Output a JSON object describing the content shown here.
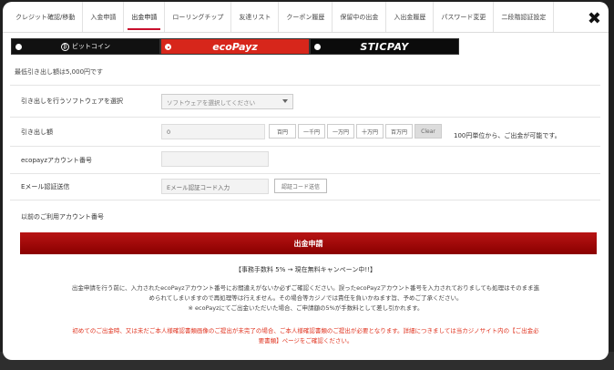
{
  "tabs": [
    {
      "label": "クレジット確認/移動"
    },
    {
      "label": "入金申請"
    },
    {
      "label": "出金申請"
    },
    {
      "label": "ローリングチップ"
    },
    {
      "label": "友達リスト"
    },
    {
      "label": "クーポン履歴"
    },
    {
      "label": "保留中の出金"
    },
    {
      "label": "入出金履歴"
    },
    {
      "label": "パスワード変更"
    },
    {
      "label": "二段階認証設定"
    }
  ],
  "active_tab": "出金申請",
  "close_label": "✖",
  "methods": {
    "bitcoin": "ビットコイン",
    "bitcoin_symbol": "₿",
    "ecopayz": "ecoPayz",
    "sticpay": "STICPAY",
    "selected": "ecoPayz"
  },
  "min_note": "最低引き出し額は5,000円です",
  "form": {
    "software_label": "引き出しを行うソフトウェアを選択",
    "software_placeholder": "ソフトウェアを選択してください",
    "amount_label": "引き出し額",
    "amount_value": "0",
    "amount_buttons": [
      "百円",
      "一千円",
      "一万円",
      "十万円",
      "百万円",
      "Clear"
    ],
    "amount_note": "100円単位から、ご出金が可能です。",
    "account_label": "ecopayzアカウント番号",
    "account_value": "",
    "email_label": "Eメール認証送信",
    "email_placeholder": "Eメール認証コード入力",
    "send_code_label": "認証コード送信",
    "previous_label": "以前のご利用アカウント番号"
  },
  "submit_label": "出金申請",
  "fee_note": "【事務手数料 5% → 現在無料キャンペーン中!!】",
  "info_lines": [
    "出金申請を行う前に、入力されたecoPayzアカウント番号にお間違えがないか必ずご確認ください。誤ったecoPayzアカウント番号を入力されておりましても処理はそのまま進",
    "められてしまいますので再処理等は行えません。その場合等カジノでは責任を負いかねます旨、予めご了承ください。",
    "※ ecoPayzにてご出金いただいた場合、ご申請額の5%が手数料として差し引かれます。"
  ],
  "warn_lines": [
    "初めてのご出金時、又は未だご本人様確認書類画像のご提出が未完了の場合、ご本人様確認書類のご提出が必要となります。詳細につきましては当カジノサイト内の【ご出金必",
    "要書類】ページをご確認ください。"
  ],
  "colors": {
    "accent": "#c8102e",
    "ecopayz": "#d7261b",
    "warning_text": "#e0331f"
  }
}
